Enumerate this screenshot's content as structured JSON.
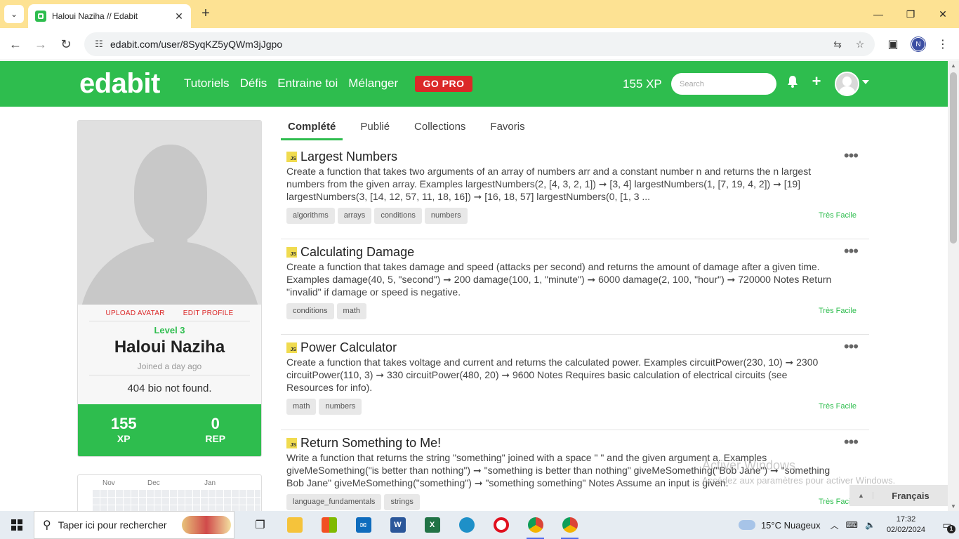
{
  "browser": {
    "tab_title": "Haloui Naziha // Edabit",
    "url": "edabit.com/user/8SyqKZ5yQWm3jJgpo",
    "profile_initial": "N"
  },
  "site": {
    "logo": "edabit",
    "nav": [
      "Tutoriels",
      "Défis",
      "Entraine toi",
      "Mélanger"
    ],
    "go_pro": "GO PRO",
    "xp": "155 XP",
    "search_placeholder": "Search",
    "brand_color": "#2ebd4e"
  },
  "profile": {
    "upload_avatar": "UPLOAD AVATAR",
    "edit_profile": "EDIT PROFILE",
    "level": "Level 3",
    "name": "Haloui Naziha",
    "joined": "Joined a day ago",
    "bio": "404 bio not found.",
    "xp_value": "155",
    "xp_label": "XP",
    "rep_value": "0",
    "rep_label": "REP",
    "calendar_months": [
      "Nov",
      "Dec",
      "Jan"
    ]
  },
  "content_tabs": [
    "Complété",
    "Publié",
    "Collections",
    "Favoris"
  ],
  "challenges": [
    {
      "title": "Largest Numbers",
      "description": "Create a function that takes two arguments of an array of numbers arr and a constant number n and returns the n largest numbers from the given array. Examples largestNumbers(2, [4, 3, 2, 1]) ➞ [3, 4] largestNumbers(1, [7, 19, 4, 2]) ➞ [19] largestNumbers(3, [14, 12, 57, 11, 18, 16]) ➞ [16, 18, 57] largestNumbers(0, [1, 3 ...",
      "tags": [
        "algorithms",
        "arrays",
        "conditions",
        "numbers"
      ],
      "difficulty": "Très Facile"
    },
    {
      "title": "Calculating Damage",
      "description": "Create a function that takes damage and speed (attacks per second) and returns the amount of damage after a given time. Examples damage(40, 5, \"second\") ➞ 200 damage(100, 1, \"minute\") ➞ 6000 damage(2, 100, \"hour\") ➞ 720000 Notes Return \"invalid\" if damage or speed is negative.",
      "tags": [
        "conditions",
        "math"
      ],
      "difficulty": "Très Facile"
    },
    {
      "title": "Power Calculator",
      "description": "Create a function that takes voltage and current and returns the calculated power. Examples circuitPower(230, 10) ➞ 2300 circuitPower(110, 3) ➞ 330 circuitPower(480, 20) ➞ 9600 Notes Requires basic calculation of electrical circuits (see Resources for info).",
      "tags": [
        "math",
        "numbers"
      ],
      "difficulty": "Très Facile"
    },
    {
      "title": "Return Something to Me!",
      "description": "Write a function that returns the string \"something\" joined with a space \" \" and the given argument a. Examples giveMeSomething(\"is better than nothing\") ➞ \"something is better than nothing\" giveMeSomething(\"Bob Jane\") ➞ \"something Bob Jane\" giveMeSomething(\"something\") ➞ \"something something\" Notes Assume an input is given.",
      "tags": [
        "language_fundamentals",
        "strings"
      ],
      "difficulty": "Très Facile"
    }
  ],
  "overlay": {
    "watermark_title": "Activer Windows",
    "watermark_sub": "Accédez aux paramètres pour activer Windows.",
    "language": "Français"
  },
  "taskbar": {
    "search_text": "Taper ici pour rechercher",
    "weather": "15°C  Nuageux",
    "time": "17:32",
    "date": "02/02/2024",
    "notif_count": "1"
  }
}
